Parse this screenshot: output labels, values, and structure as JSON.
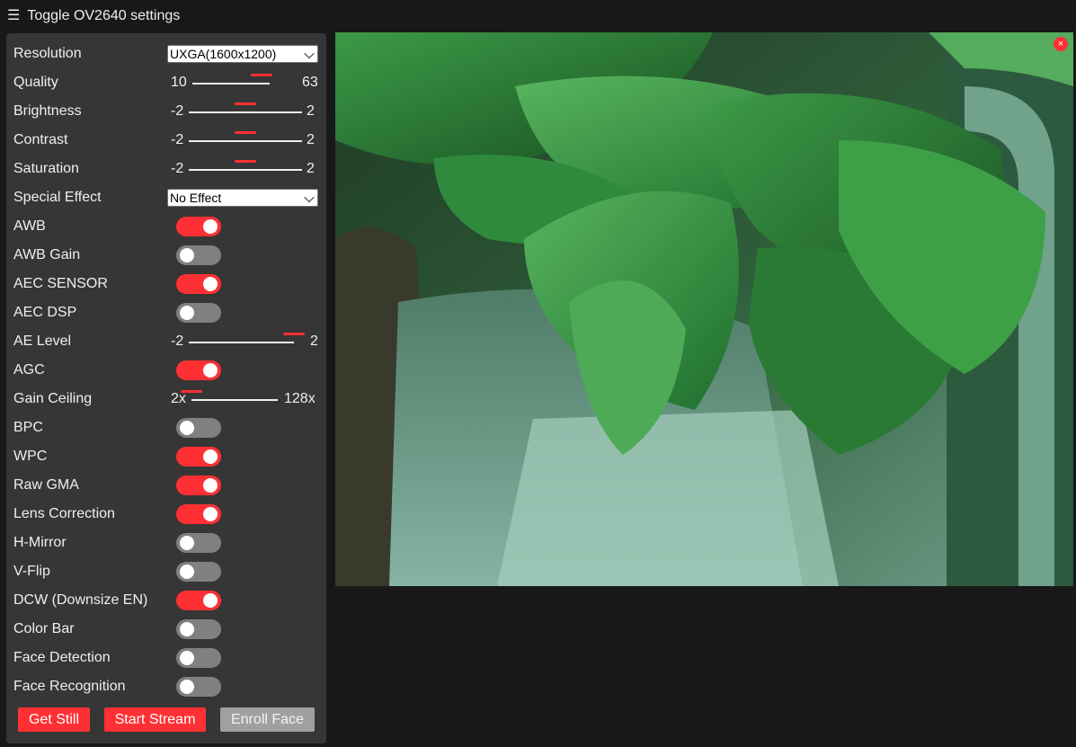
{
  "header": {
    "menu_icon": "hamburger-icon",
    "title": "Toggle OV2640 settings"
  },
  "settings": {
    "resolution": {
      "label": "Resolution",
      "value": "UXGA(1600x1200)"
    },
    "quality": {
      "label": "Quality",
      "min": "10",
      "max": "63",
      "value": 0.9
    },
    "brightness": {
      "label": "Brightness",
      "min": "-2",
      "max": "2",
      "value": 0.5
    },
    "contrast": {
      "label": "Contrast",
      "min": "-2",
      "max": "2",
      "value": 0.5
    },
    "saturation": {
      "label": "Saturation",
      "min": "-2",
      "max": "2",
      "value": 0.5
    },
    "special_effect": {
      "label": "Special Effect",
      "value": "No Effect"
    },
    "awb": {
      "label": "AWB",
      "on": true
    },
    "awb_gain": {
      "label": "AWB Gain",
      "on": false
    },
    "aec_sensor": {
      "label": "AEC SENSOR",
      "on": true
    },
    "aec_dsp": {
      "label": "AEC DSP",
      "on": false
    },
    "ae_level": {
      "label": "AE Level",
      "min": "-2",
      "max": "2",
      "value": 1.0
    },
    "agc": {
      "label": "AGC",
      "on": true
    },
    "gain_ceiling": {
      "label": "Gain Ceiling",
      "min": "2x",
      "max": "128x",
      "value": 0.0
    },
    "bpc": {
      "label": "BPC",
      "on": false
    },
    "wpc": {
      "label": "WPC",
      "on": true
    },
    "raw_gma": {
      "label": "Raw GMA",
      "on": true
    },
    "lens_correction": {
      "label": "Lens Correction",
      "on": true
    },
    "hmirror": {
      "label": "H-Mirror",
      "on": false
    },
    "vflip": {
      "label": "V-Flip",
      "on": false
    },
    "dcw": {
      "label": "DCW (Downsize EN)",
      "on": true
    },
    "colorbar": {
      "label": "Color Bar",
      "on": false
    },
    "face_detection": {
      "label": "Face Detection",
      "on": false
    },
    "face_recognition": {
      "label": "Face Recognition",
      "on": false
    }
  },
  "buttons": {
    "get_still": "Get Still",
    "start_stream": "Start Stream",
    "enroll_face": "Enroll Face"
  },
  "stream": {
    "close_icon": "close-icon",
    "close_glyph": "×"
  },
  "colors": {
    "accent": "#ff3034",
    "panel": "#363636",
    "background": "#181818",
    "switch_off": "#808080"
  }
}
